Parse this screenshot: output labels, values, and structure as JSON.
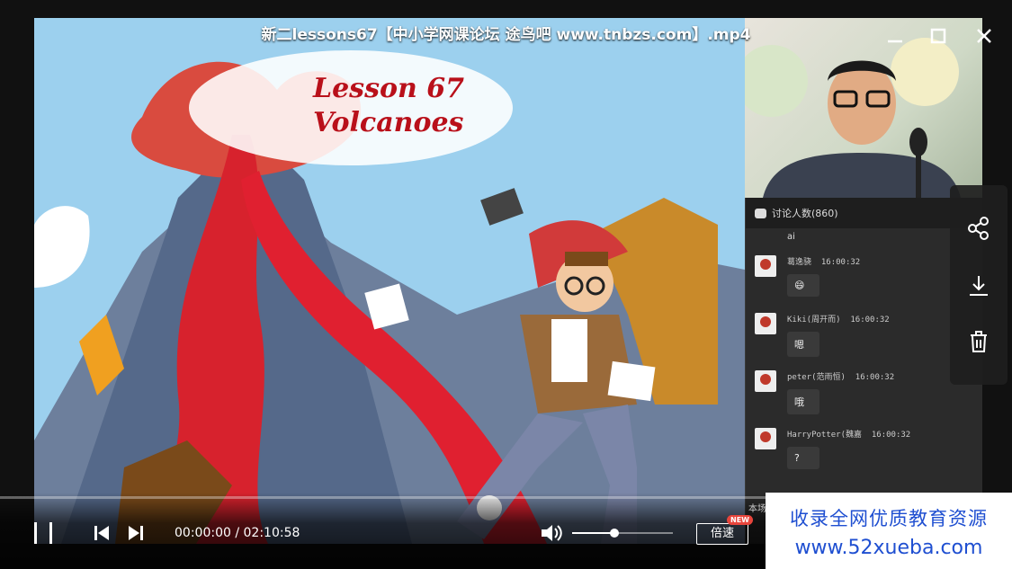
{
  "window": {
    "title": "新二lessons67【中小学网课论坛 途鸟吧 www.tnbzs.com】.mp4"
  },
  "video": {
    "lesson_line1": "Lesson 67",
    "lesson_line2": "Volcanoes"
  },
  "chat": {
    "header": "讨论人数(860)",
    "first_message_text": "ai",
    "messages": [
      {
        "author": "葛逸骁",
        "time": "16:00:32",
        "text": "😄"
      },
      {
        "author": "Kiki(周开而)",
        "time": "16:00:32",
        "text": "嗯"
      },
      {
        "author": "peter(范雨恒)",
        "time": "16:00:32",
        "text": "哦"
      },
      {
        "author": "HarryPotter(魏嘉",
        "time": "16:00:32",
        "text": "?"
      }
    ]
  },
  "controls": {
    "current_time": "00:00:00",
    "separator": " / ",
    "total_time": "02:10:58",
    "speed_label": "倍速",
    "new_badge": "NEW",
    "volume_level": 0.42,
    "progress": 0.0,
    "partial_text": "本场"
  },
  "watermark": {
    "line1": "收录全网优质教育资源",
    "line2": "www.52xueba.com"
  },
  "colors": {
    "accent_blue": "#1f4fd1",
    "badge_red": "#e8453c",
    "lesson_red": "#b9101a"
  },
  "icons": {
    "share": "share-icon",
    "download": "download-icon",
    "delete": "trash-icon",
    "pause": "pause-icon",
    "prev": "skip-previous-icon",
    "next": "skip-next-icon",
    "volume": "volume-icon",
    "minimize": "minimize-icon",
    "maximize": "maximize-icon",
    "close": "close-icon"
  }
}
